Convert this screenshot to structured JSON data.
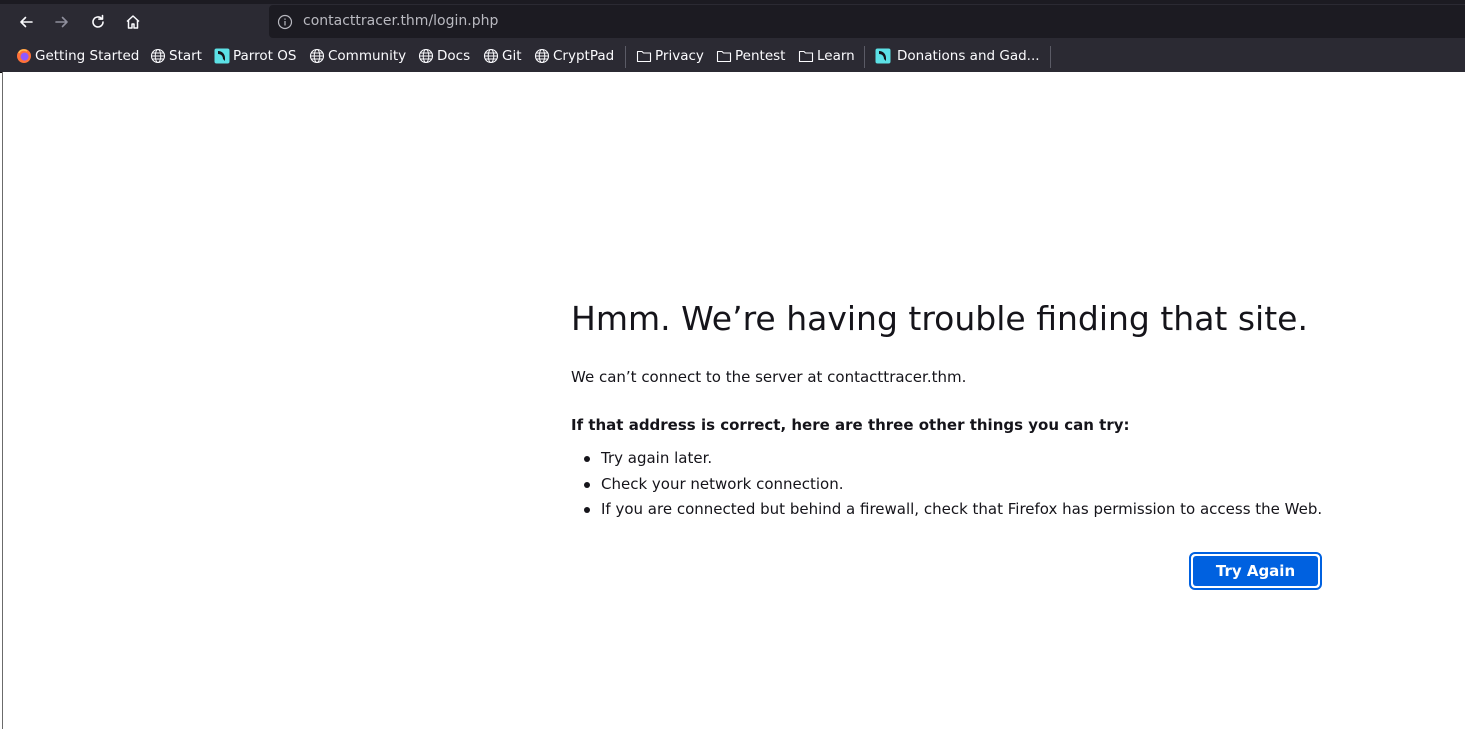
{
  "browser": {
    "url": "contacttracer.thm/login.php",
    "bookmarks": [
      {
        "label": "Getting Started",
        "icon": "firefox-icon"
      },
      {
        "label": "Start",
        "icon": "globe-icon"
      },
      {
        "label": "Parrot OS",
        "icon": "parrot-icon"
      },
      {
        "label": "Community",
        "icon": "globe-icon"
      },
      {
        "label": "Docs",
        "icon": "globe-icon"
      },
      {
        "label": "Git",
        "icon": "globe-icon"
      },
      {
        "label": "CryptPad",
        "icon": "globe-icon"
      },
      {
        "label": "Privacy",
        "icon": "folder-icon"
      },
      {
        "label": "Pentest",
        "icon": "folder-icon"
      },
      {
        "label": "Learn",
        "icon": "folder-icon"
      },
      {
        "label": "Donations and Gad...",
        "icon": "parrot-icon"
      }
    ]
  },
  "error_page": {
    "title": "Hmm. We’re having trouble finding that site.",
    "description": "We can’t connect to the server at contacttracer.thm.",
    "subheading": "If that address is correct, here are three other things you can try:",
    "suggestions": [
      "Try again later.",
      "Check your network connection.",
      "If you are connected but behind a firewall, check that Firefox has permission to access the Web."
    ],
    "button_label": "Try Again"
  },
  "colors": {
    "chrome_bg": "#2b2a33",
    "urlbar_bg": "#1c1b22",
    "primary_button": "#0061e0",
    "text": "#15141a"
  }
}
